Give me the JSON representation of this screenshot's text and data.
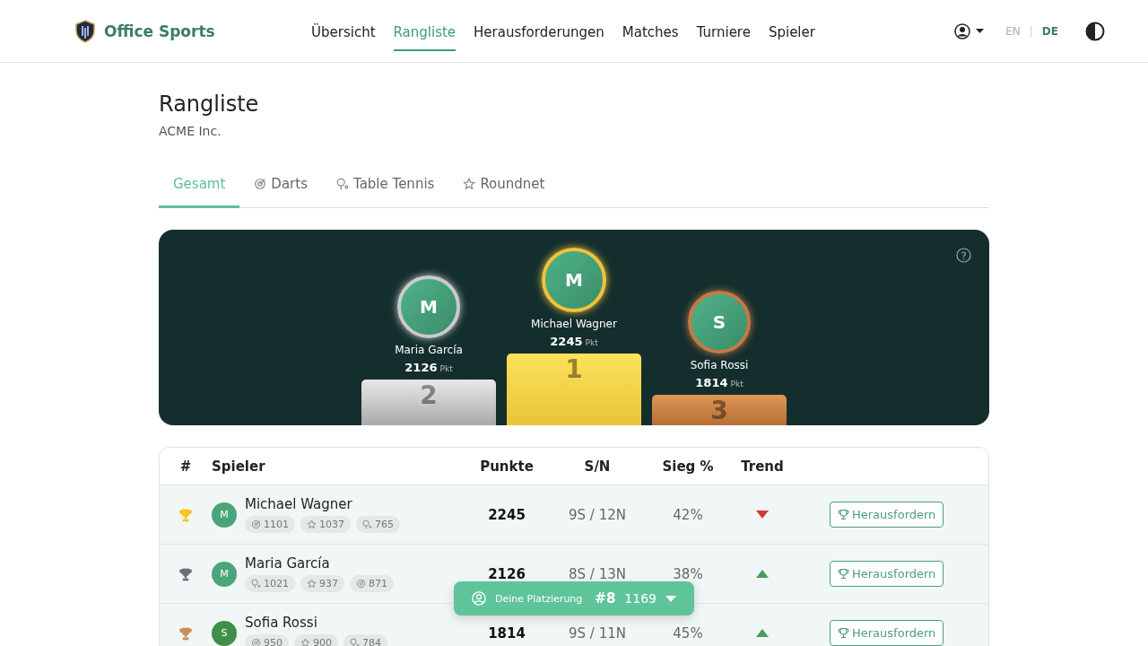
{
  "header": {
    "brand": "Office Sports",
    "nav": [
      {
        "label": "Übersicht",
        "selected": false
      },
      {
        "label": "Rangliste",
        "selected": true
      },
      {
        "label": "Herausforderungen",
        "selected": false
      },
      {
        "label": "Matches",
        "selected": false
      },
      {
        "label": "Turniere",
        "selected": false
      },
      {
        "label": "Spieler",
        "selected": false
      }
    ],
    "languages": [
      {
        "label": "EN",
        "selected": false
      },
      {
        "label": "DE",
        "selected": true
      }
    ],
    "language_separator": "|"
  },
  "page": {
    "title": "Rangliste",
    "subtitle": "ACME Inc."
  },
  "tabs": [
    {
      "label": "Gesamt",
      "kind": "all",
      "selected": true
    },
    {
      "label": "Darts",
      "kind": "darts",
      "selected": false
    },
    {
      "label": "Table Tennis",
      "kind": "tabletennis",
      "selected": false
    },
    {
      "label": "Roundnet",
      "kind": "roundnet",
      "selected": false
    }
  ],
  "podium": [
    {
      "rank": "2",
      "kind": "silver",
      "initial": "M",
      "name": "Maria García",
      "points": "2126",
      "unit": "Pkt"
    },
    {
      "rank": "1",
      "kind": "gold",
      "initial": "M",
      "name": "Michael Wagner",
      "points": "2245",
      "unit": "Pkt"
    },
    {
      "rank": "3",
      "kind": "bronze",
      "initial": "S",
      "name": "Sofia Rossi",
      "points": "1814",
      "unit": "Pkt"
    }
  ],
  "table": {
    "columns": [
      "#",
      "Spieler",
      "Punkte",
      "S/N",
      "Sieg %",
      "Trend"
    ],
    "rows": [
      {
        "color": "#f5c518",
        "initial": "M",
        "name": "Michael Wagner",
        "chips": [
          {
            "kind": "darts",
            "value": "1101"
          },
          {
            "kind": "roundnet",
            "value": "1037"
          },
          {
            "kind": "tabletennis",
            "value": "765"
          }
        ],
        "points": "2245",
        "record": "9S / 12N",
        "win_rate": "42%",
        "trending_up": false,
        "action": "Herausfordern"
      },
      {
        "color": "#6b6f72",
        "initial": "M",
        "name": "Maria García",
        "chips": [
          {
            "kind": "tabletennis",
            "value": "1021"
          },
          {
            "kind": "roundnet",
            "value": "937"
          },
          {
            "kind": "darts",
            "value": "871"
          }
        ],
        "points": "2126",
        "record": "8S / 13N",
        "win_rate": "38%",
        "trending_up": true,
        "action": "Herausfordern"
      },
      {
        "color": "#d08c55",
        "initial": "S",
        "name": "Sofia Rossi",
        "chips": [
          {
            "kind": "darts",
            "value": "950"
          },
          {
            "kind": "roundnet",
            "value": "900"
          },
          {
            "kind": "tabletennis",
            "value": "784"
          }
        ],
        "points": "1814",
        "record": "9S / 11N",
        "win_rate": "45%",
        "trending_up": true,
        "action": "Herausfordern"
      }
    ]
  },
  "my_rank": {
    "label": "Deine Platzierung",
    "rank": "#8",
    "points": "1169"
  }
}
